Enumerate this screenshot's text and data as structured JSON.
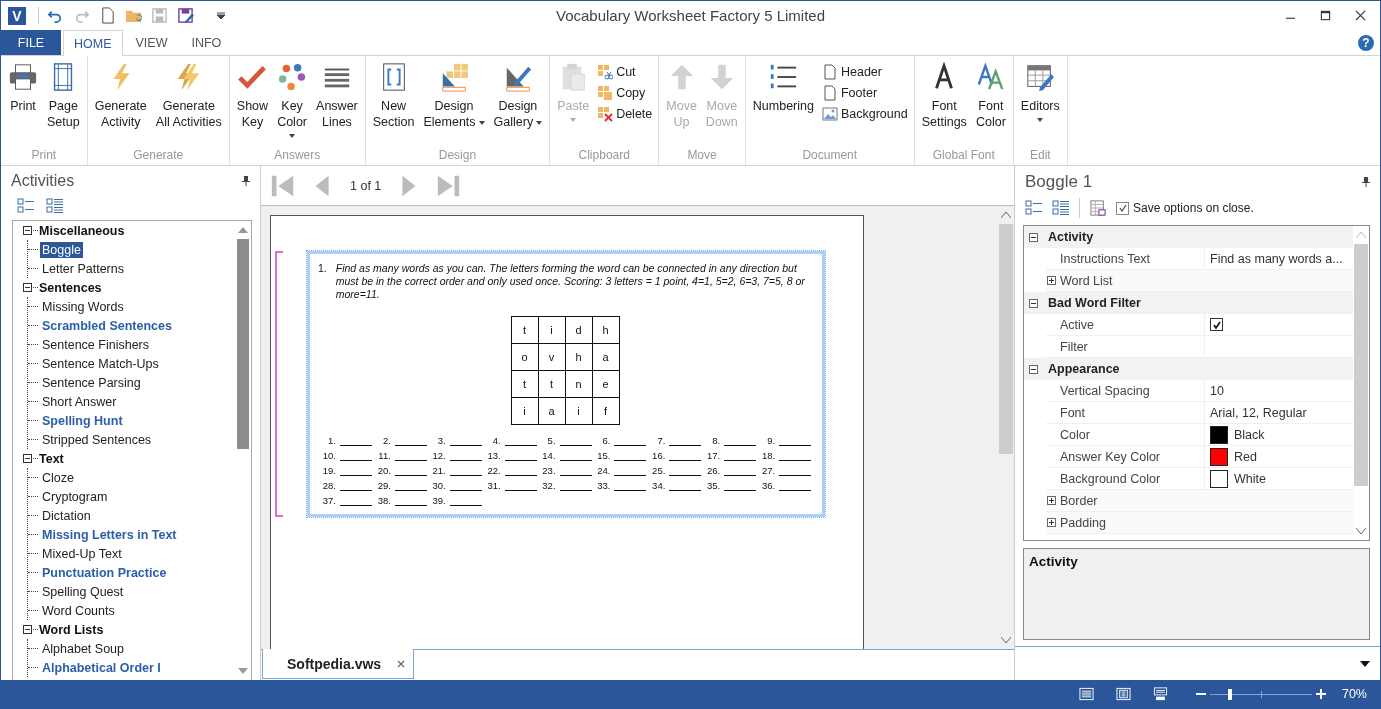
{
  "window": {
    "logo": "V",
    "title": "Vocabulary Worksheet Factory 5 Limited",
    "help": "?"
  },
  "quick_access": [
    {
      "disabled": false
    },
    {
      "disabled": true
    },
    {
      "disabled": false
    },
    {
      "disabled": false
    },
    {
      "disabled": true
    },
    {
      "disabled": false
    }
  ],
  "file_tab": "FILE",
  "tabs": [
    {
      "label": "HOME",
      "selected": true
    },
    {
      "label": "VIEW",
      "selected": false
    },
    {
      "label": "INFO",
      "selected": false
    }
  ],
  "ribbon": [
    {
      "label": "Print",
      "buttons": [
        {
          "lines": [
            "Print"
          ],
          "kind": "large",
          "disabled": false
        },
        {
          "lines": [
            "Page",
            "Setup"
          ],
          "kind": "large",
          "disabled": false
        }
      ]
    },
    {
      "label": "Generate",
      "buttons": [
        {
          "lines": [
            "Generate",
            "Activity"
          ],
          "kind": "large",
          "disabled": false
        },
        {
          "lines": [
            "Generate",
            "All Activities"
          ],
          "kind": "large",
          "disabled": false
        }
      ]
    },
    {
      "label": "Answers",
      "buttons": [
        {
          "lines": [
            "Show",
            "Key"
          ],
          "kind": "large",
          "disabled": false
        },
        {
          "lines": [
            "Key",
            "Color"
          ],
          "kind": "split",
          "disabled": false
        },
        {
          "lines": [
            "Answer",
            "Lines"
          ],
          "kind": "large",
          "disabled": false
        }
      ]
    },
    {
      "label": "Design",
      "buttons": [
        {
          "lines": [
            "New",
            "Section"
          ],
          "kind": "large",
          "disabled": false
        },
        {
          "lines": [
            "Design",
            "Elements"
          ],
          "kind": "dropdown",
          "disabled": false
        },
        {
          "lines": [
            "Design",
            "Gallery"
          ],
          "kind": "dropdown",
          "disabled": false
        }
      ]
    },
    {
      "label": "Clipboard",
      "buttons": [
        {
          "lines": [
            "Paste"
          ],
          "kind": "split",
          "disabled": true
        },
        {
          "lines": [
            "Cut"
          ],
          "kind": "small",
          "disabled": false
        },
        {
          "lines": [
            "Copy"
          ],
          "kind": "small",
          "disabled": false
        },
        {
          "lines": [
            "Delete"
          ],
          "kind": "small",
          "disabled": false
        }
      ]
    },
    {
      "label": "Move",
      "buttons": [
        {
          "lines": [
            "Move",
            "Up"
          ],
          "kind": "large",
          "disabled": true
        },
        {
          "lines": [
            "Move",
            "Down"
          ],
          "kind": "large",
          "disabled": true
        }
      ]
    },
    {
      "label": "Document",
      "buttons": [
        {
          "lines": [
            "Numbering"
          ],
          "kind": "large",
          "disabled": false
        },
        {
          "lines": [
            "Header"
          ],
          "kind": "small",
          "disabled": false
        },
        {
          "lines": [
            "Footer"
          ],
          "kind": "small",
          "disabled": false
        },
        {
          "lines": [
            "Background"
          ],
          "kind": "small",
          "disabled": false
        }
      ]
    },
    {
      "label": "Global Font",
      "buttons": [
        {
          "lines": [
            "Font",
            "Settings"
          ],
          "kind": "large",
          "disabled": false
        },
        {
          "lines": [
            "Font",
            "Color"
          ],
          "kind": "large",
          "disabled": false
        }
      ]
    },
    {
      "label": "Edit",
      "buttons": [
        {
          "lines": [
            "Editors"
          ],
          "kind": "split",
          "disabled": false
        }
      ]
    }
  ],
  "activities": {
    "title": "Activities",
    "tree": [
      {
        "label": "Miscellaneous",
        "expanded": true,
        "children": [
          {
            "label": "Boggle",
            "selected": true,
            "featured": false
          },
          {
            "label": "Letter Patterns",
            "selected": false,
            "featured": false
          }
        ]
      },
      {
        "label": "Sentences",
        "expanded": true,
        "children": [
          {
            "label": "Missing Words",
            "selected": false,
            "featured": false
          },
          {
            "label": "Scrambled Sentences",
            "selected": false,
            "featured": true
          },
          {
            "label": "Sentence Finishers",
            "selected": false,
            "featured": false
          },
          {
            "label": "Sentence Match-Ups",
            "selected": false,
            "featured": false
          },
          {
            "label": "Sentence Parsing",
            "selected": false,
            "featured": false
          },
          {
            "label": "Short Answer",
            "selected": false,
            "featured": false
          },
          {
            "label": "Spelling Hunt",
            "selected": false,
            "featured": true
          },
          {
            "label": "Stripped Sentences",
            "selected": false,
            "featured": false
          }
        ]
      },
      {
        "label": "Text",
        "expanded": true,
        "children": [
          {
            "label": "Cloze",
            "selected": false,
            "featured": false
          },
          {
            "label": "Cryptogram",
            "selected": false,
            "featured": false
          },
          {
            "label": "Dictation",
            "selected": false,
            "featured": false
          },
          {
            "label": "Missing Letters in Text",
            "selected": false,
            "featured": true
          },
          {
            "label": "Mixed-Up Text",
            "selected": false,
            "featured": false
          },
          {
            "label": "Punctuation Practice",
            "selected": false,
            "featured": true
          },
          {
            "label": "Spelling Quest",
            "selected": false,
            "featured": false
          },
          {
            "label": "Word Counts",
            "selected": false,
            "featured": false
          }
        ]
      },
      {
        "label": "Word Lists",
        "expanded": true,
        "children": [
          {
            "label": "Alphabet Soup",
            "selected": false,
            "featured": false
          },
          {
            "label": "Alphabetical Order I",
            "selected": false,
            "featured": true
          }
        ]
      }
    ]
  },
  "pager": {
    "text": "1 of 1"
  },
  "worksheet": {
    "number": "1.",
    "instructions": "Find as many words as you can. The letters forming the word can be connected in any direction but must be in the correct order and only used once. Scoring: 3 letters = 1 point, 4=1, 5=2, 6=3, 7=5, 8 or more=11.",
    "grid": [
      [
        "t",
        "i",
        "d",
        "h"
      ],
      [
        "o",
        "v",
        "h",
        "a"
      ],
      [
        "t",
        "t",
        "n",
        "e"
      ],
      [
        "i",
        "a",
        "i",
        "f"
      ]
    ],
    "answer_numbers": [
      "1.",
      "2.",
      "3.",
      "4.",
      "5.",
      "6.",
      "7.",
      "8.",
      "9.",
      "10.",
      "11.",
      "12.",
      "13.",
      "14.",
      "15.",
      "16.",
      "17.",
      "18.",
      "19.",
      "20.",
      "21.",
      "22.",
      "23.",
      "24.",
      "25.",
      "26.",
      "27.",
      "28.",
      "29.",
      "30.",
      "31.",
      "32.",
      "33.",
      "34.",
      "35.",
      "36.",
      "37.",
      "38.",
      "39."
    ]
  },
  "document_tabs": [
    {
      "label": "Softpedia.vws",
      "selected": true
    }
  ],
  "properties_panel": {
    "title": "Boggle 1",
    "save_option": {
      "label": "Save options on close.",
      "checked": true
    },
    "categories": [
      {
        "label": "Activity",
        "expanded": true,
        "rows": [
          {
            "name": "Instructions Text",
            "kind": "text",
            "value": "Find as many words a..."
          },
          {
            "name": "Word List",
            "kind": "group",
            "expanded": false
          }
        ]
      },
      {
        "label": "Bad Word Filter",
        "expanded": true,
        "rows": [
          {
            "name": "Active",
            "kind": "checkbox",
            "checked": true
          },
          {
            "name": "Filter",
            "kind": "text"
          }
        ]
      },
      {
        "label": "Appearance",
        "expanded": true,
        "rows": [
          {
            "name": "Vertical Spacing",
            "kind": "text",
            "value": "10"
          },
          {
            "name": "Font",
            "kind": "text",
            "value": "Arial, 12, Regular"
          },
          {
            "name": "Color",
            "kind": "color",
            "color": "#000000",
            "value": "Black"
          },
          {
            "name": "Answer Key Color",
            "kind": "color",
            "color": "#ff0000",
            "value": "Red"
          },
          {
            "name": "Background Color",
            "kind": "color",
            "color": "#ffffff",
            "value": "White"
          },
          {
            "name": "Border",
            "kind": "group",
            "expanded": false
          },
          {
            "name": "Padding",
            "kind": "group",
            "expanded": false
          }
        ]
      }
    ],
    "help_title": "Activity"
  },
  "status_bar": {
    "zoom": {
      "level": 0.2
    },
    "zoom_text": "70%"
  }
}
